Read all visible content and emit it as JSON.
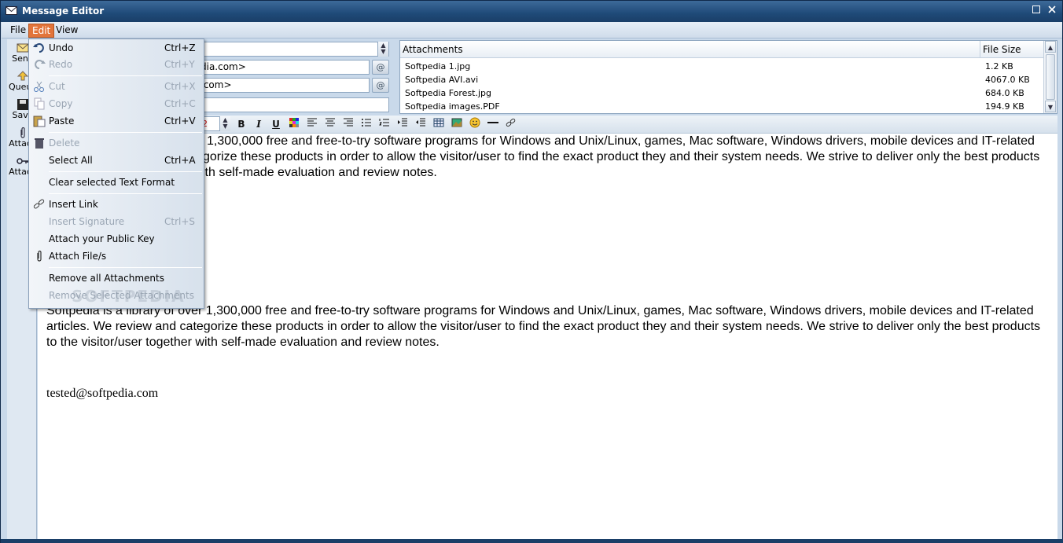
{
  "window": {
    "title": "Message Editor",
    "minimize_icon": "minimize-icon",
    "close_icon": "close-icon"
  },
  "menubar": {
    "file": "File",
    "edit": "Edit",
    "view": "View"
  },
  "sidebar": {
    "send": "Send",
    "queue": "Queue",
    "save": "Save",
    "attach": "Attach",
    "attach_key": "Attach"
  },
  "header": {
    "to_value": "dia.com>",
    "cc_value": ".com>",
    "subject_value": ""
  },
  "attachments": {
    "col_name": "Attachments",
    "col_size": "File Size",
    "rows": [
      {
        "name": "Softpedia 1.jpg",
        "size": "1.2 KB"
      },
      {
        "name": "Softpedia AVI.avi",
        "size": "4067.0 KB"
      },
      {
        "name": "Softpedia Forest.jpg",
        "size": "684.0 KB"
      },
      {
        "name": "Softpedia images.PDF",
        "size": "194.9 KB"
      }
    ]
  },
  "toolbar": {
    "font_size": "2",
    "bold": "B",
    "italic": "I",
    "underline": "U"
  },
  "body": {
    "para1_line1": "1,300,000 free and free-to-try software programs for Windows and Unix/Linux, games, Mac software, Windows drivers, mobile devices and IT-related",
    "para1_line2": "gorize these products in order to allow the visitor/user to find the exact product they and their system needs. We strive to deliver only the best products",
    "para1_line3": "ith self-made evaluation and review notes.",
    "para2_line1": "Softpedia is a library of over 1,300,000 free and free-to-try software programs for Windows and Unix/Linux, games, Mac software, Windows drivers, mobile devices and IT-related",
    "para2_line2": "articles. We review and categorize these products in order to allow the visitor/user to find the exact product they and their system needs. We strive to deliver only the best products",
    "para2_line3": "to the visitor/user together with self-made evaluation and review notes.",
    "signature": "tested@softpedia.com",
    "watermark": "SOFTPEDIA"
  },
  "edit_menu": {
    "undo": {
      "label": "Undo",
      "shortcut": "Ctrl+Z"
    },
    "redo": {
      "label": "Redo",
      "shortcut": "Ctrl+Y"
    },
    "cut": {
      "label": "Cut",
      "shortcut": "Ctrl+X"
    },
    "copy": {
      "label": "Copy",
      "shortcut": "Ctrl+C"
    },
    "paste": {
      "label": "Paste",
      "shortcut": "Ctrl+V"
    },
    "delete": {
      "label": "Delete"
    },
    "select_all": {
      "label": "Select All",
      "shortcut": "Ctrl+A"
    },
    "clear_format": {
      "label": "Clear selected Text Format"
    },
    "insert_link": {
      "label": "Insert Link"
    },
    "insert_signature": {
      "label": "Insert Signature",
      "shortcut": "Ctrl+S"
    },
    "attach_public_key": {
      "label": "Attach your Public Key"
    },
    "attach_files": {
      "label": "Attach File/s"
    },
    "remove_all": {
      "label": "Remove all Attachments"
    },
    "remove_selected": {
      "label": "Remove Selected Attachments"
    }
  },
  "colors": {
    "titlebar": "#1f4a78",
    "menu_active": "#e2743a",
    "chrome": "#c9d9ea"
  }
}
